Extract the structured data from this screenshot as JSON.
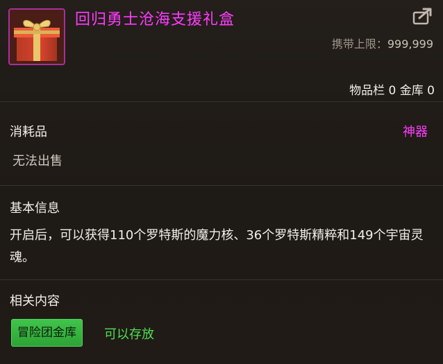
{
  "item": {
    "name": "回归勇士沧海支援礼盒",
    "icon": "gift-box-icon",
    "carry_limit_label": "携带上限：",
    "carry_limit_value": "999,999",
    "storage": "物品栏 0 金库 0"
  },
  "properties": {
    "type": "消耗品",
    "rarity": "神器",
    "trade": "无法出售"
  },
  "basic_info": {
    "heading": "基本信息",
    "description": "开启后，可以获得110个罗特斯的魔力核、36个罗特斯精粹和149个宇宙灵魂。"
  },
  "related": {
    "heading": "相关内容",
    "tag_label": "冒险团金库",
    "tag_status": "可以存放"
  },
  "colors": {
    "rarity_artifact": "#ff3cff",
    "storable_green": "#4ee052",
    "tag_green": "#3fc54a"
  }
}
